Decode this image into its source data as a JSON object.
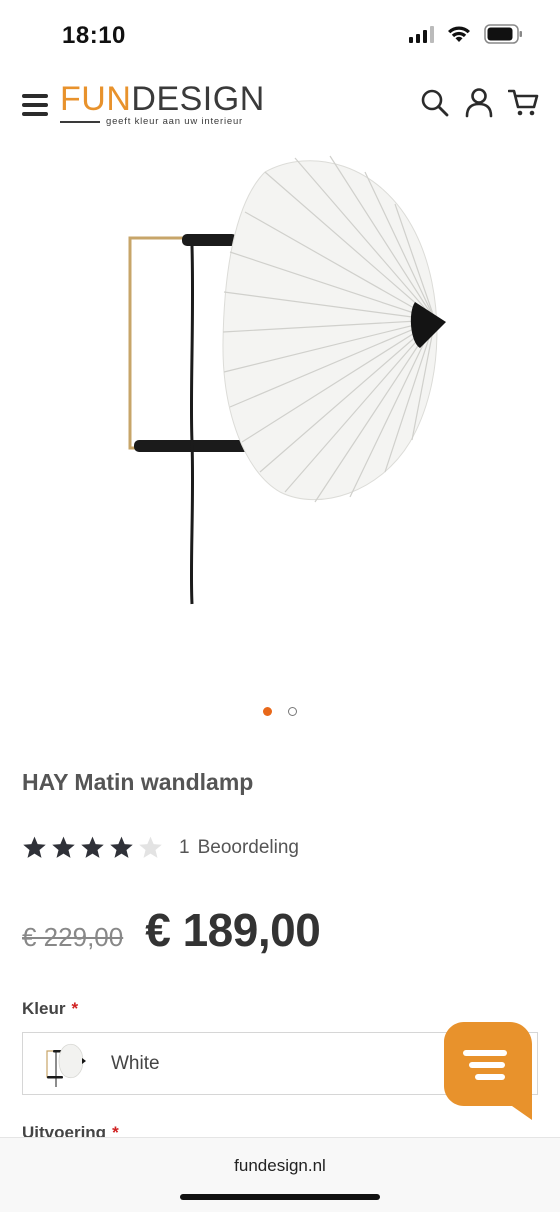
{
  "status_bar": {
    "time": "18:10"
  },
  "header": {
    "logo": {
      "part1": "FUN",
      "part2": "DESIGN",
      "tagline": "geeft kleur aan uw interieur"
    },
    "icons": [
      "menu-icon",
      "search-icon",
      "account-icon",
      "cart-icon"
    ]
  },
  "gallery": {
    "image_count": 2,
    "active_index": 0
  },
  "product": {
    "title": "HAY Matin wandlamp",
    "rating": {
      "stars": 4,
      "max": 5,
      "count": "1",
      "label": "Beoordeling"
    },
    "old_price": "€ 229,00",
    "price": "€ 189,00"
  },
  "options": {
    "color": {
      "label": "Kleur",
      "required_mark": "*",
      "selected": "White"
    },
    "variant": {
      "label": "Uitvoering",
      "required_mark": "*"
    }
  },
  "colors": {
    "accent": "#e8922c",
    "dot_active": "#e8681a",
    "required": "#d02020"
  },
  "browser": {
    "url": "fundesign.nl"
  }
}
